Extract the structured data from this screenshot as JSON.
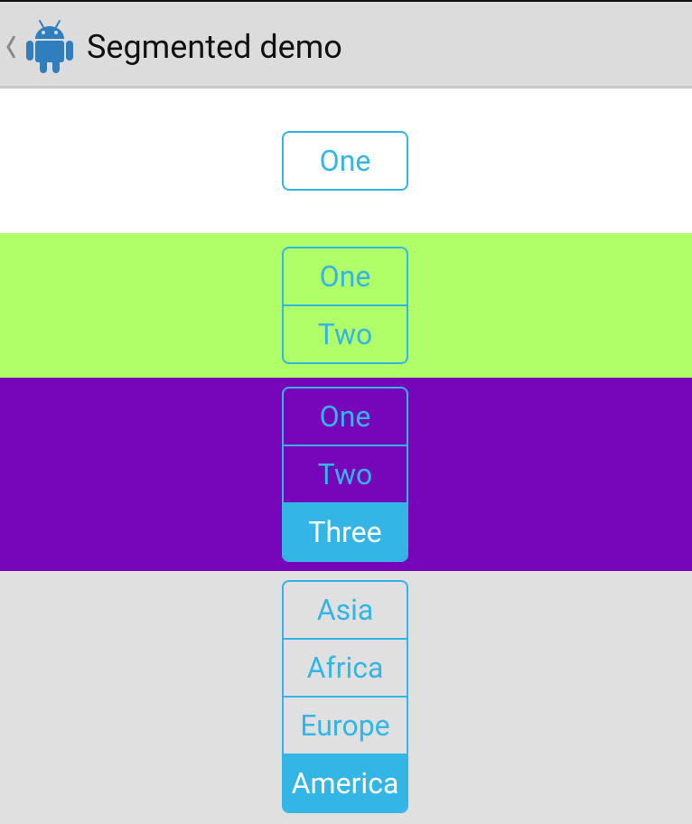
{
  "actionbar": {
    "title": "Segmented demo",
    "up_icon": "chevron-left-icon",
    "app_icon": "android-robot-icon",
    "icon_color": "#2f7fbf"
  },
  "colors": {
    "accent": "#33b5e5",
    "section_backgrounds": [
      "#ffffff",
      "#b1ff68",
      "#7706bb",
      "#e0e0e0"
    ]
  },
  "groups": [
    {
      "options": [
        {
          "label": "One",
          "checked": false
        }
      ]
    },
    {
      "options": [
        {
          "label": "One",
          "checked": false
        },
        {
          "label": "Two",
          "checked": false
        }
      ]
    },
    {
      "options": [
        {
          "label": "One",
          "checked": false
        },
        {
          "label": "Two",
          "checked": false
        },
        {
          "label": "Three",
          "checked": true
        }
      ]
    },
    {
      "options": [
        {
          "label": "Asia",
          "checked": false
        },
        {
          "label": "Africa",
          "checked": false
        },
        {
          "label": "Europe",
          "checked": false
        },
        {
          "label": "America",
          "checked": true
        }
      ]
    }
  ]
}
